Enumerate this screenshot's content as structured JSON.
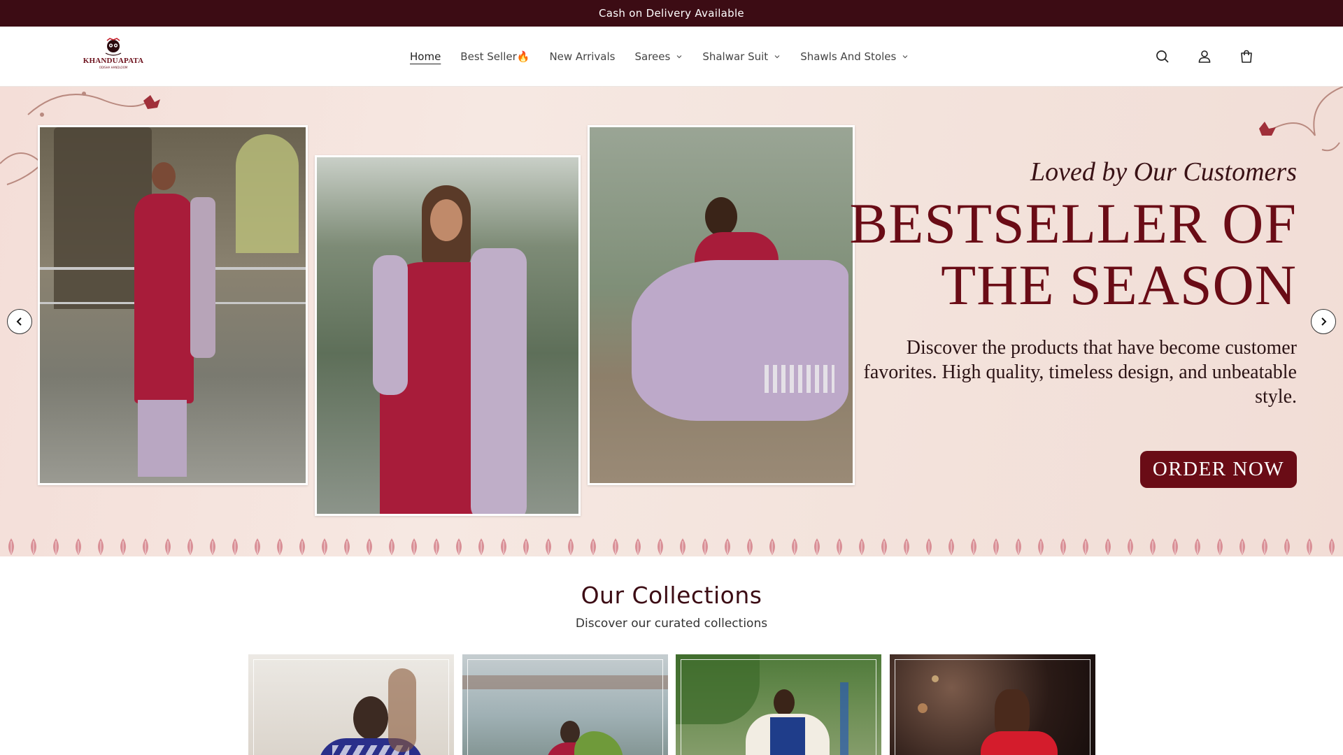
{
  "announcement": "Cash on Delivery Available",
  "brand": {
    "name": "KHANDUAPATA",
    "tagline": "ODISHA HANDLOOM",
    "color": "#6b0f1a"
  },
  "nav": [
    {
      "label": "Home",
      "active": true
    },
    {
      "label": "Best Seller🔥"
    },
    {
      "label": "New Arrivals"
    },
    {
      "label": "Sarees",
      "dropdown": true
    },
    {
      "label": "Shalwar Suit",
      "dropdown": true
    },
    {
      "label": "Shawls And Stoles",
      "dropdown": true
    }
  ],
  "header_icons": [
    "search-icon",
    "account-icon",
    "cart-icon"
  ],
  "hero": {
    "subtitle": "Loved by Our Customers",
    "title_line1": "BESTSELLER OF",
    "title_line2": "THE SEASON",
    "description": "Discover the products that have become customer favorites. High quality, timeless design, and unbeatable style.",
    "cta": "ORDER NOW",
    "accent": "#6a0c16",
    "prev_icon": "chevron-left-icon",
    "next_icon": "chevron-right-icon"
  },
  "collections": {
    "title": "Our Collections",
    "subtitle": "Discover our curated collections"
  },
  "colors": {
    "announcement_bg": "#3c0c14",
    "brand_maroon": "#6a0c16",
    "hero_bg": "#f4e2dc"
  }
}
